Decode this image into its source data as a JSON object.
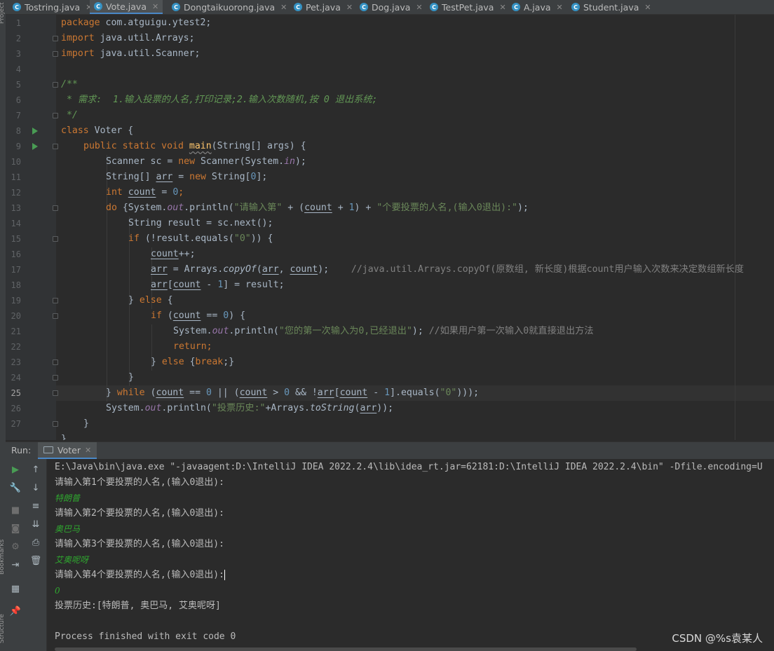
{
  "tabs": [
    {
      "label": "Tostring.java",
      "active": false
    },
    {
      "label": "Vote.java",
      "active": true
    },
    {
      "label": "Dongtaikuorong.java",
      "active": false
    },
    {
      "label": "Pet.java",
      "active": false
    },
    {
      "label": "Dog.java",
      "active": false
    },
    {
      "label": "TestPet.java",
      "active": false
    },
    {
      "label": "A.java",
      "active": false
    },
    {
      "label": "Student.java",
      "active": false
    }
  ],
  "side_labels": {
    "project": "Project",
    "bookmarks": "Bookmarks",
    "structure": "Structure"
  },
  "editor": {
    "line_numbers": [
      "1",
      "2",
      "3",
      "4",
      "5",
      "6",
      "7",
      "8",
      "9",
      "10",
      "11",
      "12",
      "13",
      "14",
      "15",
      "16",
      "17",
      "18",
      "19",
      "20",
      "21",
      "22",
      "23",
      "24",
      "25",
      "26",
      "27"
    ],
    "current_line": "25",
    "code": {
      "l1_kw": "package",
      "l1_rest": " com.atguigu.ytest2;",
      "l2_kw": "import",
      "l2_rest": " java.util.Arrays;",
      "l3_kw": "import",
      "l3_rest": " java.util.Scanner;",
      "l5": "/**",
      "l6": " * 需求:  1.输入投票的人名,打印记录;2.输入次数随机,按 0 退出系统;",
      "l7": " */",
      "l8_kw": "class",
      "l8_rest": " Voter {",
      "l9_kw": "public static void",
      "l9_method": "main",
      "l9_rest": "(String[] args) {",
      "l10_a": "Scanner sc = ",
      "l10_kw": "new",
      "l10_b": " Scanner(System.",
      "l10_f": "in",
      "l10_c": ");",
      "l11_a": "String[] ",
      "l11_var": "arr",
      "l11_b": " = ",
      "l11_kw": "new",
      "l11_c": " String[",
      "l11_n": "0",
      "l11_d": "];",
      "l12_kw": "int",
      "l12_var": "count",
      "l12_b": " = ",
      "l12_n": "0",
      "l12_c": ";",
      "l13_kw": "do",
      "l13_a": " {System.",
      "l13_f": "out",
      "l13_b": ".println(",
      "l13_s1": "\"请输入第\"",
      "l13_c": " + (",
      "l13_var": "count",
      "l13_d": " + ",
      "l13_n": "1",
      "l13_e": ") + ",
      "l13_s2": "\"个要投票的人名,(输入0退出):\"",
      "l13_g": ");",
      "l14": "String result = sc.next();",
      "l15_kw": "if",
      "l15_a": " (!result.equals(",
      "l15_s": "\"0\"",
      "l15_b": ")) {",
      "l16_var": "count",
      "l16_b": "++;",
      "l17_var1": "arr",
      "l17_a": " = Arrays.",
      "l17_m": "copyOf",
      "l17_b": "(",
      "l17_var2": "arr",
      "l17_c": ", ",
      "l17_var3": "count",
      "l17_d": ");",
      "l17_cm": "//java.util.Arrays.copyOf(原数组, 新长度)根据count用户输入次数来决定数组新长度",
      "l18_var1": "arr",
      "l18_a": "[",
      "l18_var2": "count",
      "l18_b": " - ",
      "l18_n": "1",
      "l18_c": "] = result;",
      "l19_a": "} ",
      "l19_kw": "else",
      "l19_b": " {",
      "l20_kw": "if",
      "l20_a": " (",
      "l20_var": "count",
      "l20_b": " == ",
      "l20_n": "0",
      "l20_c": ") {",
      "l21_a": "System.",
      "l21_f": "out",
      "l21_b": ".println(",
      "l21_s": "\"您的第一次输入为0,已经退出\"",
      "l21_c": ");",
      "l21_cm": "//如果用户第一次输入0就直接退出方法",
      "l22_kw": "return",
      "l22_a": ";",
      "l23_a": "} ",
      "l23_kw": "else",
      "l23_b": " {",
      "l23_kw2": "break",
      "l23_c": ";}",
      "l24": "}",
      "l25_a": "} ",
      "l25_kw": "while",
      "l25_b": " (",
      "l25_var1": "count",
      "l25_c": " == ",
      "l25_n1": "0",
      "l25_d": " || (",
      "l25_var2": "count",
      "l25_e": " > ",
      "l25_n2": "0",
      "l25_g": " && !",
      "l25_var3": "arr",
      "l25_h": "[",
      "l25_var4": "count",
      "l25_i": " - ",
      "l25_n3": "1",
      "l25_j": "].equals(",
      "l25_s": "\"0\"",
      "l25_k": ")));",
      "l26_a": "System.",
      "l26_f": "out",
      "l26_b": ".println(",
      "l26_s": "\"投票历史:\"",
      "l26_c": "+Arrays.",
      "l26_m": "toString",
      "l26_d": "(",
      "l26_var": "arr",
      "l26_e": "));",
      "l27": "}",
      "l28": "}"
    }
  },
  "run": {
    "label": "Run:",
    "tab_label": "Voter",
    "console_lines": [
      {
        "text": "E:\\Java\\bin\\java.exe \"-javaagent:D:\\IntelliJ IDEA 2022.2.4\\lib\\idea_rt.jar=62181:D:\\IntelliJ IDEA 2022.2.4\\bin\" -Dfile.encoding=U",
        "kind": "out"
      },
      {
        "text": "请输入第1个要投票的人名,(输入0退出):",
        "kind": "out"
      },
      {
        "text": "特朗普",
        "kind": "in"
      },
      {
        "text": "请输入第2个要投票的人名,(输入0退出):",
        "kind": "out"
      },
      {
        "text": "奥巴马",
        "kind": "in"
      },
      {
        "text": "请输入第3个要投票的人名,(输入0退出):",
        "kind": "out"
      },
      {
        "text": "艾奥呢呀",
        "kind": "in"
      },
      {
        "text": "请输入第4个要投票的人名,(输入0退出):",
        "kind": "out"
      },
      {
        "text": "0",
        "kind": "in"
      },
      {
        "text": "投票历史:[特朗普, 奥巴马, 艾奥呢呀]",
        "kind": "out"
      },
      {
        "text": "",
        "kind": "out"
      },
      {
        "text": "Process finished with exit code 0",
        "kind": "out"
      }
    ]
  },
  "watermark": "CSDN @%s袁某人"
}
